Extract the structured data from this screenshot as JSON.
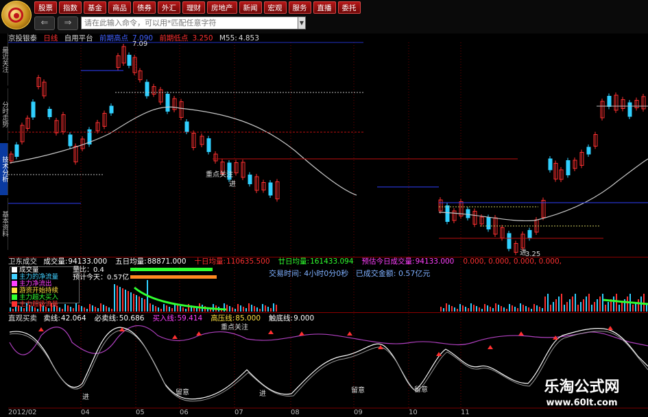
{
  "toolbar": {
    "menu": [
      "股票",
      "指数",
      "基金",
      "商品",
      "债券",
      "外汇",
      "理财",
      "房地产",
      "新闻",
      "宏观",
      "服务",
      "直播",
      "委托"
    ],
    "command_placeholder": "请在此输入命令，可以用*匹配任意字符"
  },
  "left_tabs": [
    "最近关注",
    "分时走势",
    "技术分析",
    "基本资料"
  ],
  "stock_header": {
    "name": "京投银泰",
    "period": "日线",
    "mode": "自用平台",
    "indicator1": "前期高点",
    "indicator1_value": "7.090",
    "indicator2": "前期低点",
    "indicator2_value": "3.250",
    "ma_label": "M55:",
    "ma_value": "4.853"
  },
  "price_labels": {
    "high": "7.09",
    "low": "3.25"
  },
  "chart_annotations": [
    "重点关注",
    "进"
  ],
  "volume_header": {
    "title": "卫东成交",
    "items": [
      {
        "label": "成交量:",
        "value": "94133.000",
        "color": "#ffffff"
      },
      {
        "label": "五日均量:",
        "value": "88871.000",
        "color": "#ffffff"
      },
      {
        "label": "十日均量:",
        "value": "110635.500",
        "color": "#ff3030"
      },
      {
        "label": "廿日均量:",
        "value": "161433.094",
        "color": "#30ff30"
      },
      {
        "label": "预估今日成交量:",
        "value": "94133.000",
        "color": "#ff40ff"
      },
      {
        "label": "",
        "value": "0.000, 0.000, 0.000, 0.000,",
        "color": "#ff3030"
      }
    ]
  },
  "volume_legend": [
    {
      "label": "成交量",
      "color": "#ffffff"
    },
    {
      "label": "主力的净流量",
      "color": "#40d0ff"
    },
    {
      "label": "主力净流出",
      "color": "#ff40ff"
    },
    {
      "label": "游资开始持续",
      "color": "#ffe040"
    },
    {
      "label": "主力超大买入",
      "color": "#30ff30"
    },
    {
      "label": "主力超级流量",
      "color": "#ff3030"
    }
  ],
  "volume_stats": {
    "volume_ratio_label": "量比：",
    "volume_ratio": "0.4",
    "estimate_label": "预计今天：",
    "estimate": "0.57亿"
  },
  "trade_info": {
    "time_label": "交易时间:",
    "time_value": "4小时0分0秒",
    "amount_label": "已成交金额:",
    "amount_value": "0.57亿元"
  },
  "oscillator_header": {
    "title": "直观买卖",
    "items": [
      {
        "label": "卖线:",
        "value": "42.064",
        "color": "#ffffff"
      },
      {
        "label": "必卖线:",
        "value": "50.686",
        "color": "#ffffff"
      },
      {
        "label": "买入线:",
        "value": "59.414",
        "color": "#ff40ff"
      },
      {
        "label": "高压线:",
        "value": "85.000",
        "color": "#ffe040"
      },
      {
        "label": "触底线:",
        "value": "9.000",
        "color": "#ffffff"
      }
    ]
  },
  "oscillator_annotations": [
    "重点关注",
    "进",
    "留意"
  ],
  "date_axis": [
    "2012/02",
    "04",
    "05",
    "06",
    "07",
    "08",
    "09",
    "10",
    "11"
  ],
  "watermark": {
    "title": "乐淘公式网",
    "url": "www.60lt.com"
  },
  "colors": {
    "up": "#ff3030",
    "down": "#30d0ff",
    "ma": "#c8c8c8",
    "grid": "#8b0000",
    "menu": "#b31616"
  }
}
